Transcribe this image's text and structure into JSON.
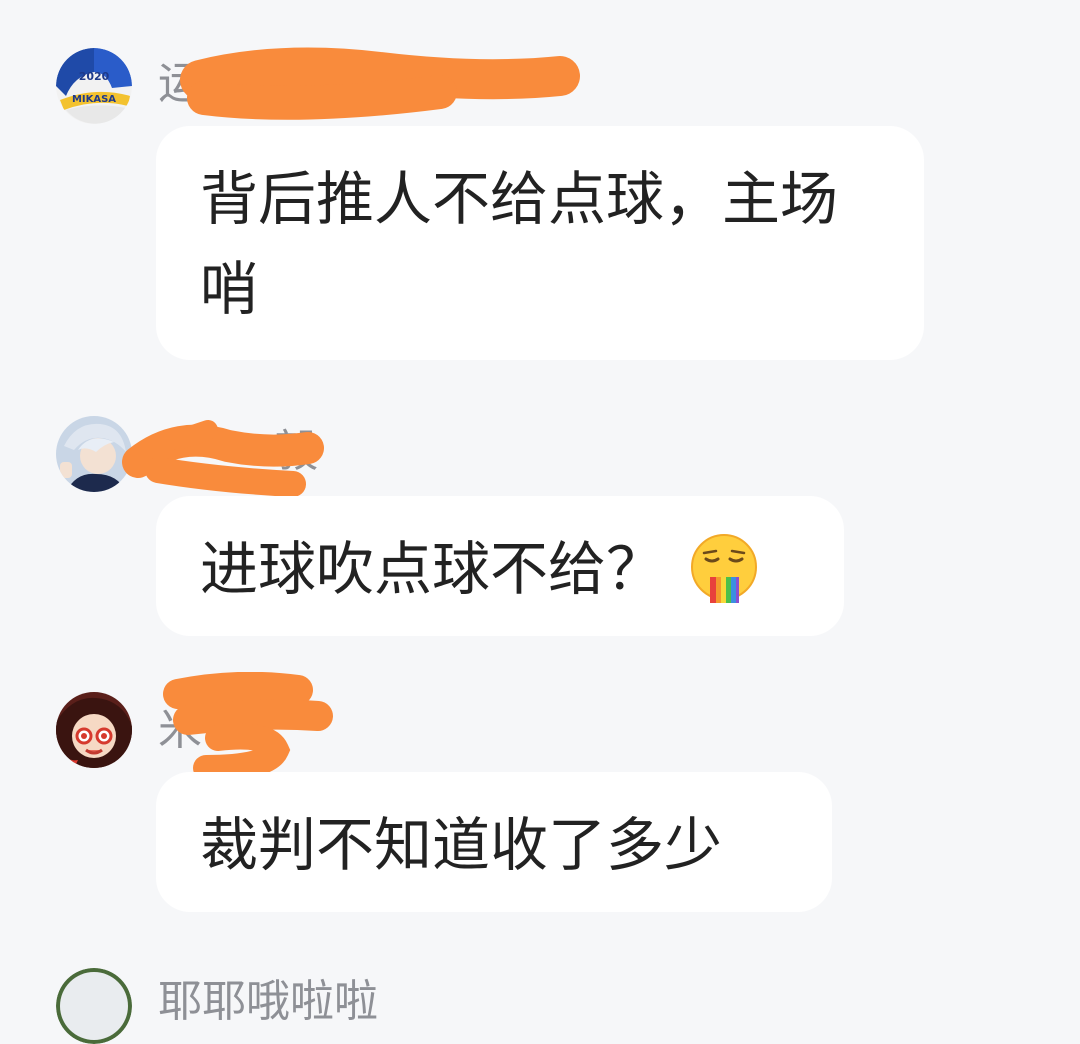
{
  "comments": [
    {
      "nickname": "运 t06",
      "text": "背后推人不给点球，主场哨",
      "avatar_icon": "volleyball-icon",
      "avatar_text": "2020 MIKASA"
    },
    {
      "nickname": "毅",
      "text": "进球吹点球不给？",
      "avatar_icon": "anime-boy-avatar-icon",
      "emoji_icon": "rainbow-vomit-emoji-icon"
    },
    {
      "nickname": "米 哥",
      "text": "裁判不知道收了多少",
      "avatar_icon": "anime-character-avatar-icon"
    },
    {
      "nickname": "耶耶哦啦啦",
      "avatar_icon": "user-avatar-icon"
    }
  ],
  "colors": {
    "background": "#f6f7f9",
    "bubble": "#ffffff",
    "nickname": "#8e9096",
    "message_text": "#222222",
    "redaction": "#f98b3c"
  }
}
